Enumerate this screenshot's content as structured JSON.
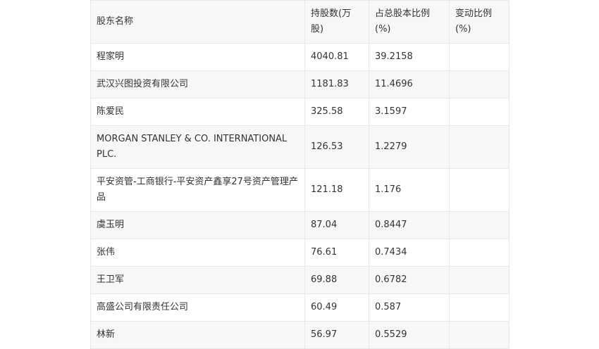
{
  "table": {
    "headers": [
      "股东名称",
      "持股数(万股)",
      "占总股本比例(%)",
      "变动比例(%)"
    ],
    "rows": [
      [
        "程家明",
        "4040.81",
        "39.2158",
        ""
      ],
      [
        "武汉兴图投资有限公司",
        "1181.83",
        "11.4696",
        ""
      ],
      [
        "陈爱民",
        "325.58",
        "3.1597",
        ""
      ],
      [
        "MORGAN STANLEY & CO. INTERNATIONAL PLC.",
        "126.53",
        "1.2279",
        ""
      ],
      [
        "平安资管-工商银行-平安资产鑫享27号资产管理产品",
        "121.18",
        "1.176",
        ""
      ],
      [
        "虞玉明",
        "87.04",
        "0.8447",
        ""
      ],
      [
        "张伟",
        "76.61",
        "0.7434",
        ""
      ],
      [
        "王卫军",
        "69.88",
        "0.6782",
        ""
      ],
      [
        "高盛公司有限责任公司",
        "60.49",
        "0.587",
        ""
      ],
      [
        "林新",
        "56.97",
        "0.5529",
        ""
      ]
    ]
  }
}
